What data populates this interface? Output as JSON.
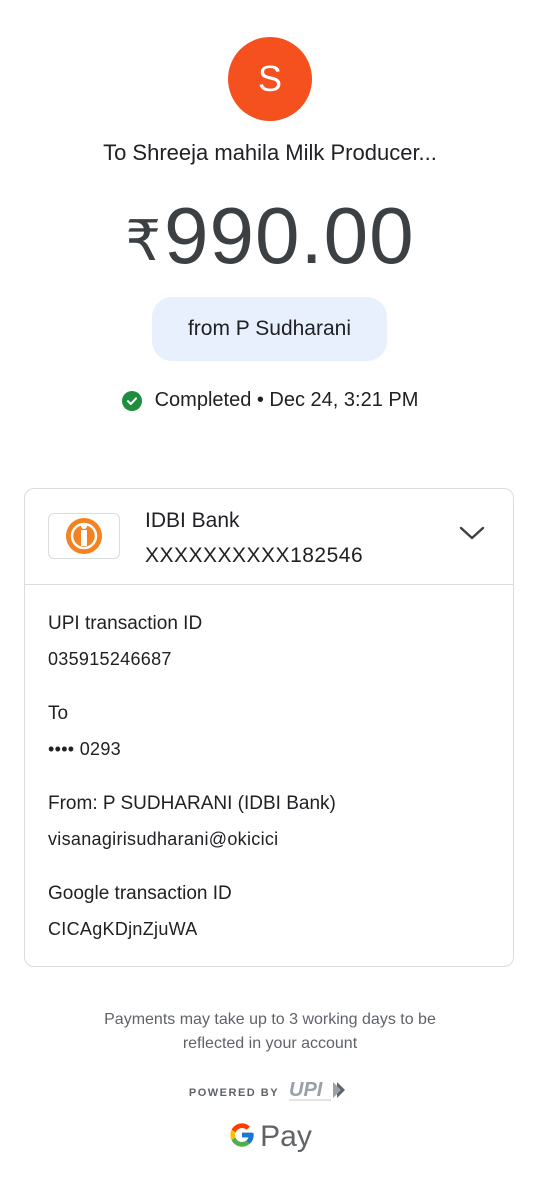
{
  "header": {
    "avatar_letter": "S",
    "recipient": "To Shreeja mahila Milk Producer...",
    "currency_symbol": "₹",
    "amount": "990.00",
    "from_label": "from P Sudharani",
    "status": "Completed • Dec 24, 3:21 PM"
  },
  "bank": {
    "name": "IDBI Bank",
    "account": "XXXXXXXXXX182546"
  },
  "details": [
    {
      "label": "UPI transaction ID",
      "value": "035915246687"
    },
    {
      "label": "To",
      "value": "•••• 0293"
    },
    {
      "label": "From: P SUDHARANI (IDBI Bank)",
      "value": "visanagirisudharani@okicici"
    },
    {
      "label": "Google transaction ID",
      "value": "CICAgKDjnZjuWA"
    }
  ],
  "footer": {
    "note_line1": "Payments may take up to 3 working days to be",
    "note_line2": "reflected in your account",
    "powered_by": "POWERED BY",
    "upi_logo": "UPI",
    "gpay_label": "Pay"
  },
  "colors": {
    "avatar": "#f4511e",
    "pill": "#e8f0fe",
    "success": "#1e8e3e"
  }
}
